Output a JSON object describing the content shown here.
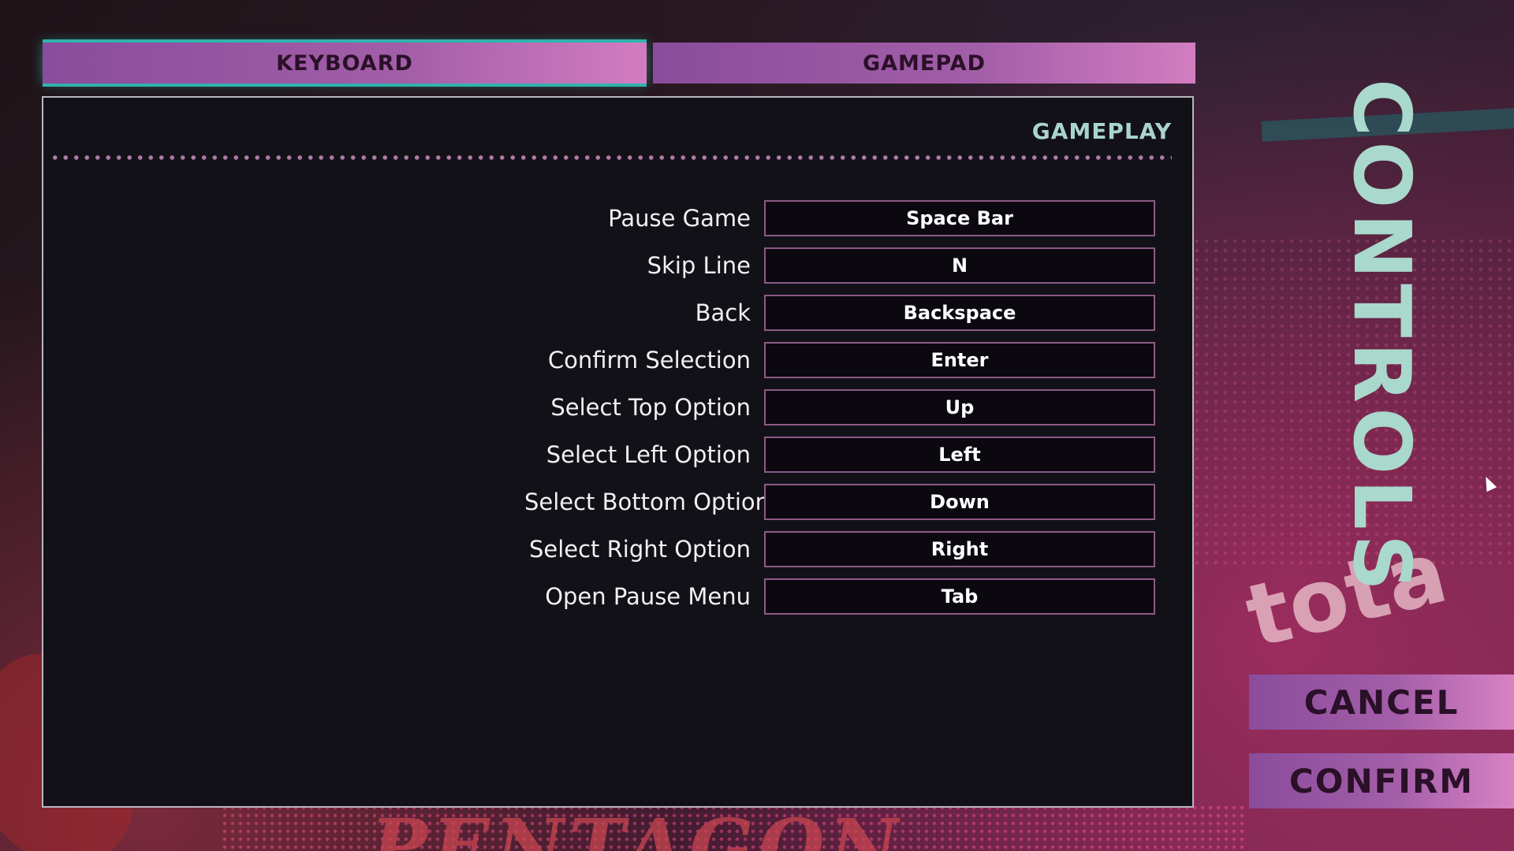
{
  "tabs": {
    "keyboard": "KEYBOARD",
    "gamepad": "GAMEPAD",
    "active": "KEYBOARD"
  },
  "panel": {
    "section_title": "GAMEPLAY",
    "bindings": [
      {
        "action": "Pause Game",
        "key": "Space Bar"
      },
      {
        "action": "Skip Line",
        "key": "N"
      },
      {
        "action": "Back",
        "key": "Backspace"
      },
      {
        "action": "Confirm Selection",
        "key": "Enter"
      },
      {
        "action": "Select Top Option",
        "key": "Up"
      },
      {
        "action": "Select Left Option",
        "key": "Left"
      },
      {
        "action": "Select Bottom Option",
        "key": "Down"
      },
      {
        "action": "Select Right Option",
        "key": "Right"
      },
      {
        "action": "Open Pause Menu",
        "key": "Tab"
      }
    ]
  },
  "heading": "CONTROLS",
  "buttons": {
    "cancel": "CANCEL",
    "confirm": "CONFIRM"
  },
  "background": {
    "art_text_right": "tota",
    "art_text_bottom": "PENTAGON"
  },
  "colors": {
    "accent_teal": "#2fb3ad",
    "button_purple": "#a35ea8",
    "heading_mint": "#a9d8cc",
    "panel_bg": "#121118"
  }
}
